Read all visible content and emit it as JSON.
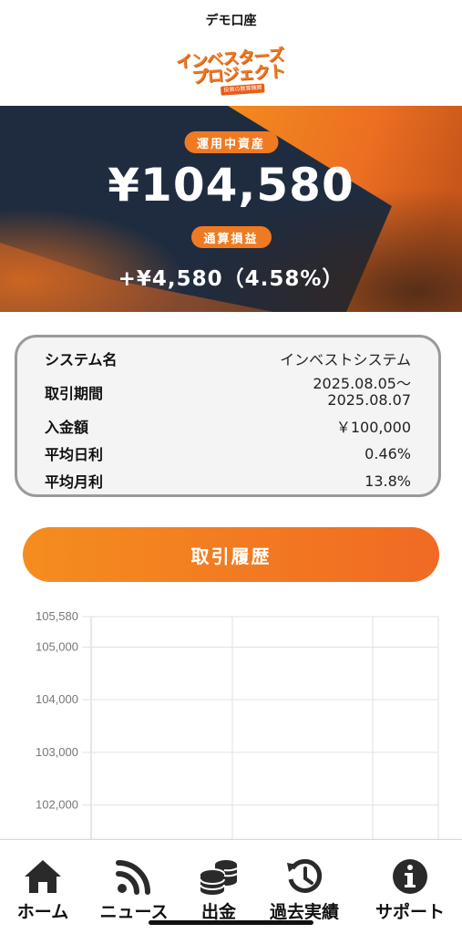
{
  "app": {
    "title": "デモ口座"
  },
  "logo": {
    "line1": "インベスターズ",
    "line2": "プロジェクト",
    "tag": "投資の教育機関"
  },
  "hero": {
    "asset_label": "運用中資産",
    "balance": "¥104,580",
    "pnl_label": "通算損益",
    "pnl": "+¥4,580（4.58%）"
  },
  "info": {
    "system_label": "システム名",
    "system_value": "インベストシステム",
    "period_label": "取引期間",
    "period_start": "2025.08.05〜",
    "period_end": "2025.08.07",
    "deposit_label": "入金額",
    "deposit_value": "￥100,000",
    "daily_label": "平均日利",
    "daily_value": "0.46%",
    "monthly_label": "平均月利",
    "monthly_value": "13.8%"
  },
  "buttons": {
    "history": "取引履歴"
  },
  "chart_data": {
    "type": "line",
    "title": "",
    "xlabel": "",
    "ylabel": "",
    "y_ticks": [
      105580,
      105000,
      104000,
      103000,
      102000
    ],
    "y_tick_labels": [
      "105,580",
      "105,000",
      "104,000",
      "103,000",
      "102,000"
    ],
    "ylim_visible": [
      101800,
      105580
    ],
    "grid": true,
    "series": []
  },
  "nav": {
    "items": [
      {
        "label": "ホーム",
        "icon": "home-icon"
      },
      {
        "label": "ニュース",
        "icon": "rss-icon"
      },
      {
        "label": "出金",
        "icon": "coins-icon"
      },
      {
        "label": "過去実績",
        "icon": "history-icon"
      },
      {
        "label": "サポート",
        "icon": "info-icon"
      }
    ]
  },
  "colors": {
    "accent": "#f07a22",
    "accent_dark": "#e85d1a",
    "hero_navy": "#1d2a3e",
    "card_border": "#9a9a9a"
  }
}
